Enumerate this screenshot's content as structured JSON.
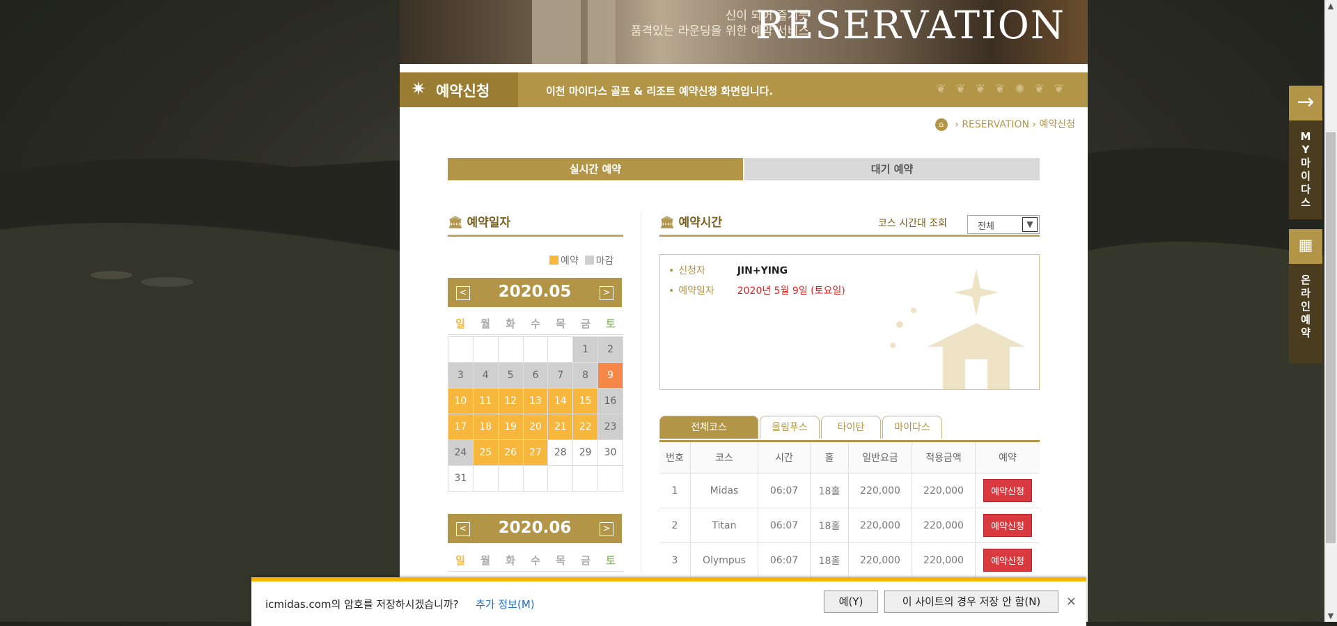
{
  "hero": {
    "subtitle_1": "신이 되어 즐기듯",
    "subtitle_2": "품격있는 라운딩을 위한 예약 서비스",
    "title": "RESERVATION"
  },
  "banner": {
    "title": "예약신청",
    "description": "이천 마이다스 골프 & 리조트 예약신청 화면입니다."
  },
  "breadcrumb": {
    "home_icon": "home-icon",
    "sep1": "›",
    "section": "RESERVATION",
    "sep2": "›",
    "current": "예약신청"
  },
  "main_tabs": {
    "realtime": "실시간 예약",
    "waitlist": "대기 예약"
  },
  "date_section": {
    "title": "예약일자",
    "legend_open": "예약",
    "legend_closed": "마감",
    "colors": {
      "open": "#f6b73c",
      "closed": "#cfcfcf",
      "selected": "#f58849"
    },
    "dow": [
      "일",
      "월",
      "화",
      "수",
      "목",
      "금",
      "토"
    ],
    "cal1": {
      "ym": "2020.05",
      "prev": "<",
      "next": ">"
    },
    "cal2": {
      "ym": "2020.06",
      "prev": "<",
      "next": ">"
    },
    "may_days": [
      [
        "",
        "",
        "",
        "",
        "",
        "1",
        "2"
      ],
      [
        "3",
        "4",
        "5",
        "6",
        "7",
        "8",
        "9"
      ],
      [
        "10",
        "11",
        "12",
        "13",
        "14",
        "15",
        "16"
      ],
      [
        "17",
        "18",
        "19",
        "20",
        "21",
        "22",
        "23"
      ],
      [
        "24",
        "25",
        "26",
        "27",
        "28",
        "29",
        "30"
      ],
      [
        "31",
        "",
        "",
        "",
        "",
        "",
        ""
      ]
    ]
  },
  "time_section": {
    "title": "예약시간",
    "filter_label": "코스 시간대 조회",
    "filter_value": "전체",
    "applicant_label": "신청자",
    "applicant_value": "JIN+YING",
    "date_label": "예약일자",
    "date_value": "2020년 5월 9일 (토요일)"
  },
  "course_tabs": [
    "전체코스",
    "올림푸스",
    "타이탄",
    "마이다스"
  ],
  "table": {
    "headers": [
      "번호",
      "코스",
      "시간",
      "홀",
      "일반요금",
      "적용금액",
      "예약"
    ],
    "rows": [
      {
        "no": "1",
        "course": "Midas",
        "time": "06:07",
        "hole": "18홀",
        "fee": "220,000",
        "applied": "220,000",
        "btn": "예약신청"
      },
      {
        "no": "2",
        "course": "Titan",
        "time": "06:07",
        "hole": "18홀",
        "fee": "220,000",
        "applied": "220,000",
        "btn": "예약신청"
      },
      {
        "no": "3",
        "course": "Olympus",
        "time": "06:07",
        "hole": "18홀",
        "fee": "220,000",
        "applied": "220,000",
        "btn": "예약신청"
      }
    ]
  },
  "side": {
    "my_label": "MY마이다스",
    "online_label": "온라인예약",
    "arrow_icon": "arrow-right-icon",
    "calendar_icon": "calendar-icon"
  },
  "password_bar": {
    "message": "icmidas.com의 암호를 저장하시겠습니까?",
    "more_info": "추가 정보(M)",
    "yes": "예(Y)",
    "never": "이 사이트의 경우 저장 안 함(N)",
    "close": "×"
  }
}
